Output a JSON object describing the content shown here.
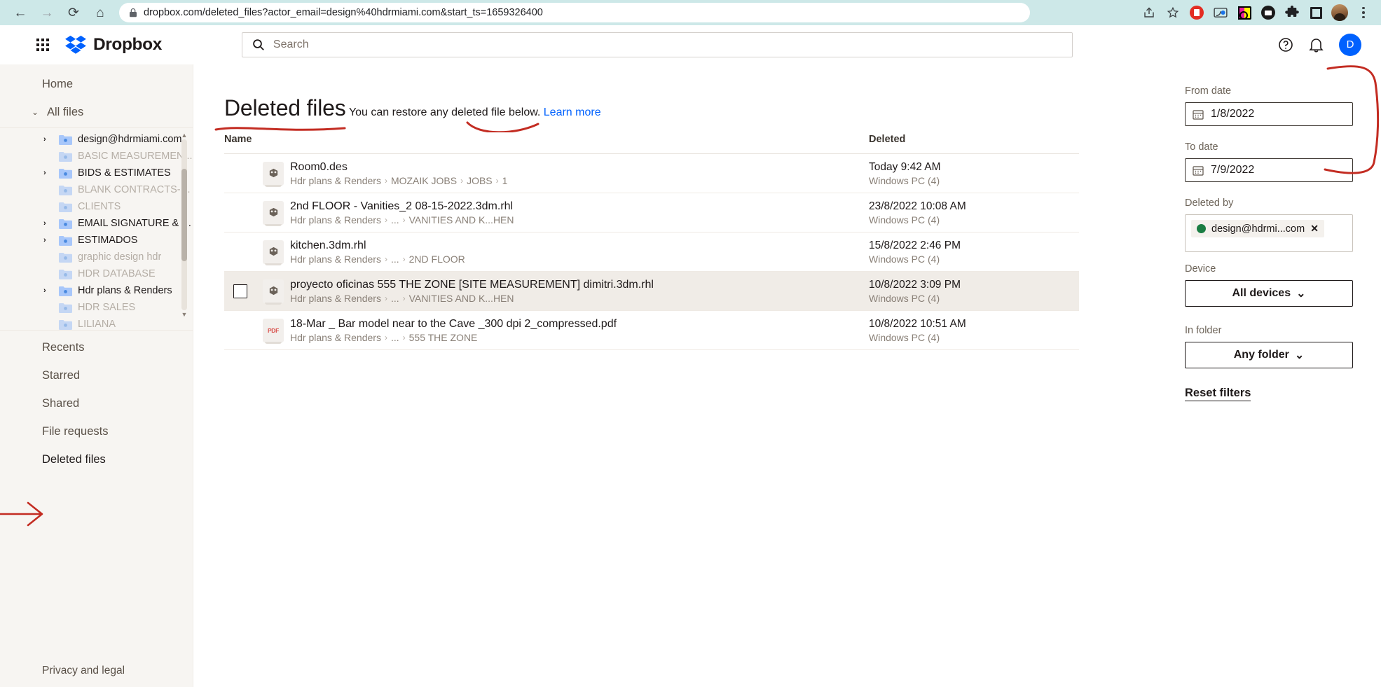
{
  "browser": {
    "url": "dropbox.com/deleted_files?actor_email=design%40hdrmiami.com&start_ts=1659326400",
    "back_label": "←",
    "forward_label": "→",
    "reload_label": "⟳",
    "home_label": "⌂",
    "share_icon": "share-icon",
    "bookmark_icon": "star-icon",
    "ext_icons": [
      "adblock-icon",
      "cast-icon",
      "colorzilla-icon",
      "dark-reader-icon",
      "extensions-puzzle-icon",
      "reading-list-icon"
    ],
    "profile_icon": "profile-avatar",
    "menu_icon": "kebab-menu-icon"
  },
  "header": {
    "app_grid_icon": "app-grid-icon",
    "brand": "Dropbox",
    "search_placeholder": "Search",
    "help_icon": "help-icon",
    "bell_icon": "notifications-icon",
    "avatar_initial": "D"
  },
  "sidebar": {
    "home": "Home",
    "all_files": "All files",
    "tree": [
      {
        "label": "design@hdrmiami.com",
        "twisty": true,
        "dim": false,
        "shared": true
      },
      {
        "label": "BASIC MEASUREMEN...",
        "twisty": false,
        "dim": true,
        "shared": false
      },
      {
        "label": "BIDS & ESTIMATES",
        "twisty": true,
        "dim": false,
        "shared": true
      },
      {
        "label": "BLANK CONTRACTS-L...",
        "twisty": false,
        "dim": true,
        "shared": false
      },
      {
        "label": "CLIENTS",
        "twisty": false,
        "dim": true,
        "shared": false
      },
      {
        "label": "EMAIL SIGNATURE & T...",
        "twisty": true,
        "dim": false,
        "shared": true
      },
      {
        "label": "ESTIMADOS",
        "twisty": true,
        "dim": false,
        "shared": true
      },
      {
        "label": "graphic design hdr",
        "twisty": false,
        "dim": true,
        "shared": false
      },
      {
        "label": "HDR DATABASE",
        "twisty": false,
        "dim": true,
        "shared": false
      },
      {
        "label": "Hdr plans & Renders",
        "twisty": true,
        "dim": false,
        "shared": true
      },
      {
        "label": "HDR SALES",
        "twisty": false,
        "dim": true,
        "shared": false
      },
      {
        "label": "LILIANA",
        "twisty": false,
        "dim": true,
        "shared": false
      }
    ],
    "nav": [
      {
        "label": "Recents",
        "active": false
      },
      {
        "label": "Starred",
        "active": false
      },
      {
        "label": "Shared",
        "active": false
      },
      {
        "label": "File requests",
        "active": false
      },
      {
        "label": "Deleted files",
        "active": true
      }
    ],
    "footer": "Privacy and legal"
  },
  "main": {
    "title": "Deleted files",
    "subtitle_text": "You can restore any deleted file below. ",
    "subtitle_link": "Learn more",
    "columns": {
      "name": "Name",
      "deleted": "Deleted"
    },
    "rows": [
      {
        "name": "Room0.des",
        "path": [
          "Hdr plans & Renders",
          "MOZAIK JOBS",
          "JOBS",
          "1"
        ],
        "deleted_at": "Today 9:42 AM",
        "device": "Windows PC (4)",
        "icon": "3d-file-icon",
        "selected": false
      },
      {
        "name": "2nd FLOOR - Vanities_2 08-15-2022.3dm.rhl",
        "path": [
          "Hdr plans & Renders",
          "...",
          "VANITIES AND K...HEN"
        ],
        "deleted_at": "23/8/2022 10:08 AM",
        "device": "Windows PC (4)",
        "icon": "3d-file-icon",
        "selected": false
      },
      {
        "name": "kitchen.3dm.rhl",
        "path": [
          "Hdr plans & Renders",
          "...",
          "2ND FLOOR"
        ],
        "deleted_at": "15/8/2022 2:46 PM",
        "device": "Windows PC (4)",
        "icon": "3d-file-icon",
        "selected": false
      },
      {
        "name": "proyecto oficinas 555 THE ZONE [SITE MEASUREMENT] dimitri.3dm.rhl",
        "path": [
          "Hdr plans & Renders",
          "...",
          "VANITIES AND K...HEN"
        ],
        "deleted_at": "10/8/2022 3:09 PM",
        "device": "Windows PC (4)",
        "icon": "3d-file-icon",
        "selected": true
      },
      {
        "name": "18-Mar _ Bar model near to the Cave _300 dpi 2_compressed.pdf",
        "path": [
          "Hdr plans & Renders",
          "...",
          "555 THE ZONE"
        ],
        "deleted_at": "10/8/2022 10:51 AM",
        "device": "Windows PC (4)",
        "icon": "pdf-file-icon",
        "selected": false
      }
    ]
  },
  "filters": {
    "from_label": "From date",
    "from_value": "1/8/2022",
    "to_label": "To date",
    "to_value": "7/9/2022",
    "deleted_by_label": "Deleted by",
    "deleted_by_chip": "design@hdrmi...com",
    "chip_remove": "✕",
    "device_label": "Device",
    "device_value": "All devices",
    "folder_label": "In folder",
    "folder_value": "Any folder",
    "reset_label": "Reset filters"
  },
  "colors": {
    "browser_bar": "#cde8e8",
    "dropbox_blue": "#0061fe",
    "sidebar_bg": "#f7f5f2",
    "selected_row": "#f0ece7",
    "annotation_red": "#c32c22",
    "chip_green": "#1a7d43"
  }
}
